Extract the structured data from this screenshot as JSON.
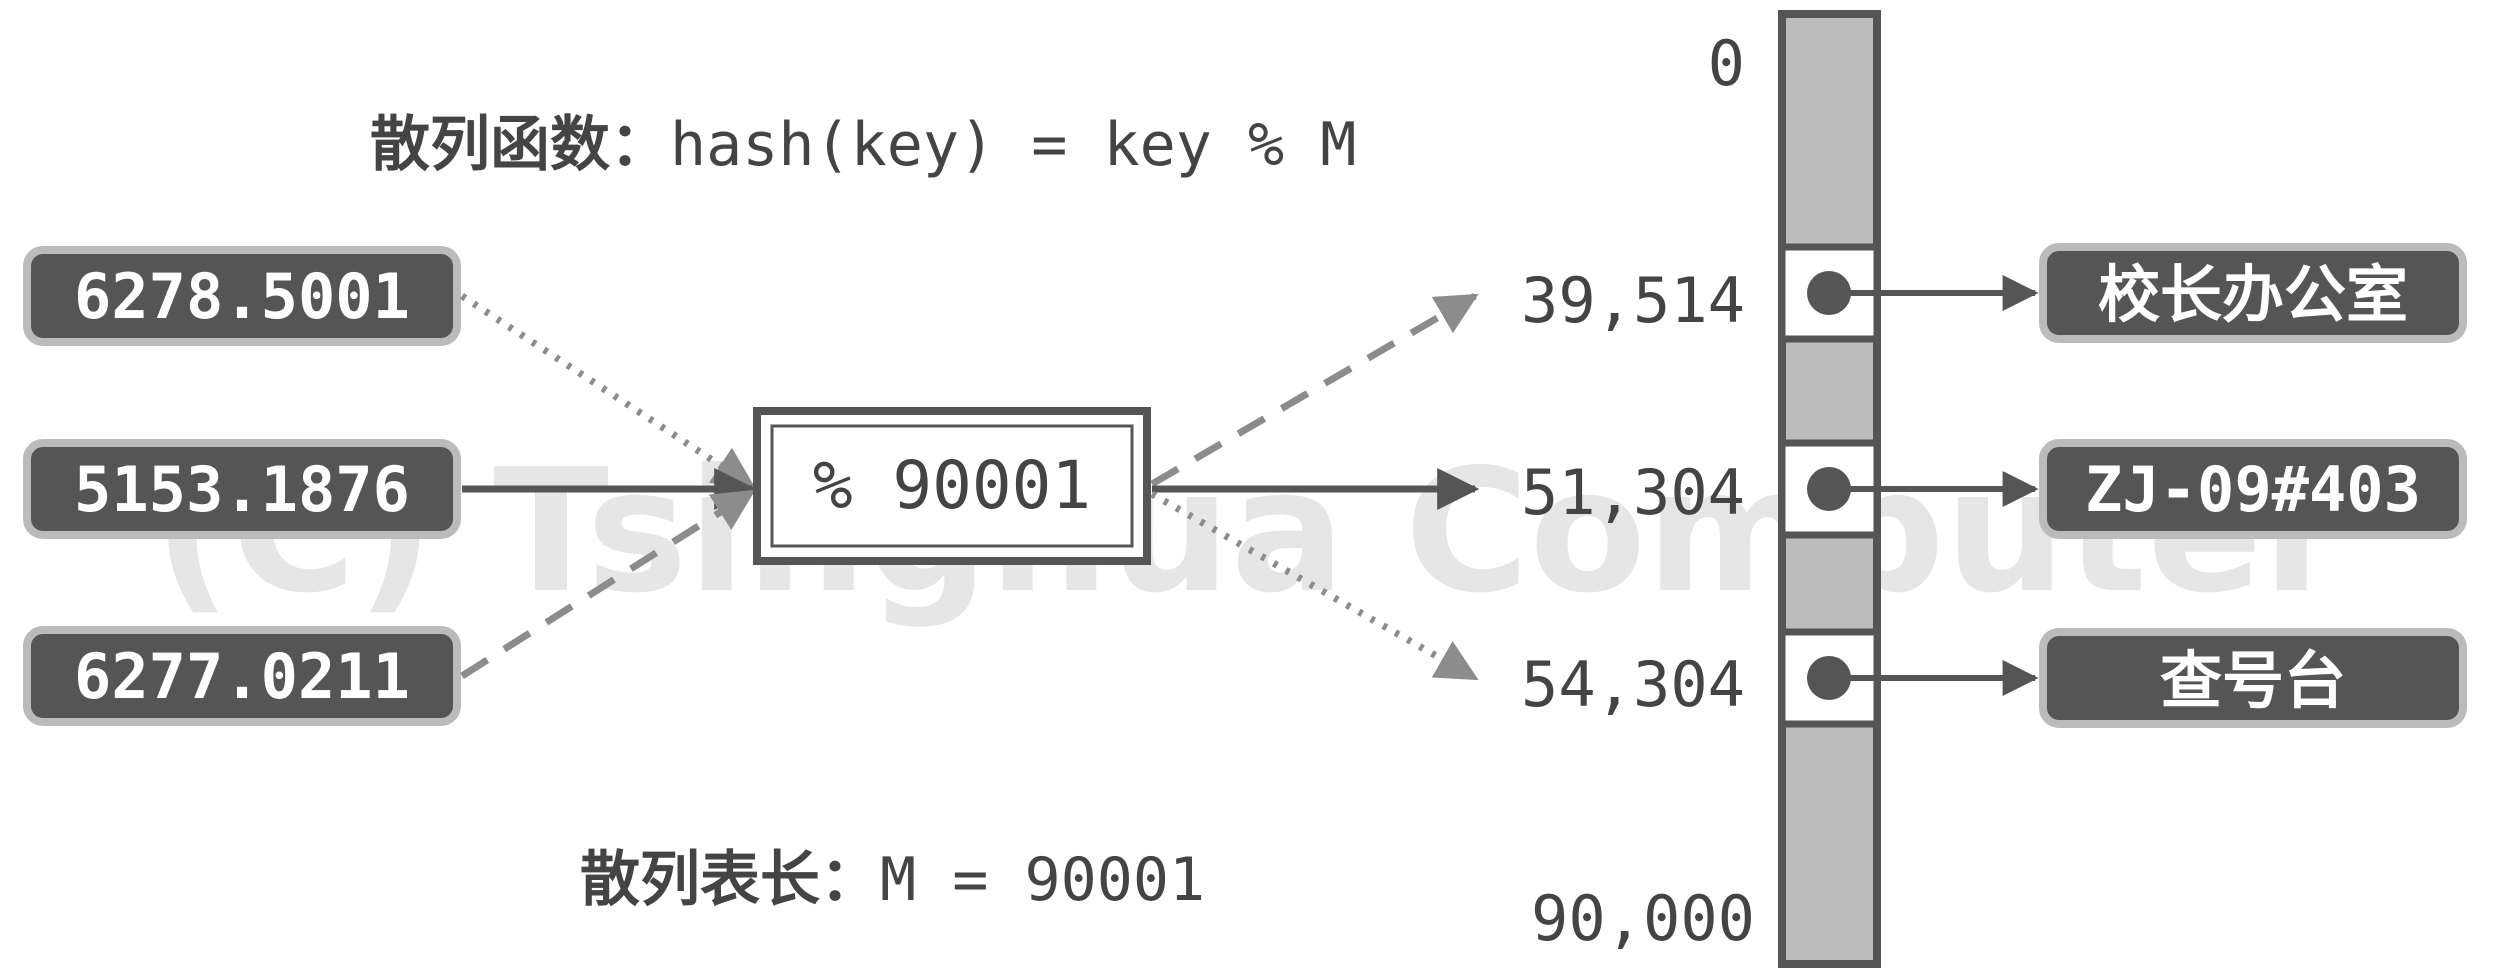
{
  "hash_function": {
    "label": "散列函数：",
    "formula": "hash(key) = key % M"
  },
  "table_length": {
    "label": "散列表长：",
    "formula": "M = 90001"
  },
  "keys": [
    {
      "text": "6278.5001",
      "edge_style": "dotted"
    },
    {
      "text": "5153.1876",
      "edge_style": "solid"
    },
    {
      "text": "6277.0211",
      "edge_style": "dashed"
    }
  ],
  "operator": {
    "text": "% 90001"
  },
  "bucket_indices": {
    "first": "0",
    "last": "90,000",
    "slots": [
      "39,514",
      "51,304",
      "54,304"
    ]
  },
  "values": [
    "校长办公室",
    "ZJ-09#403",
    "查号台"
  ],
  "watermark": "(C) Tsinghua Computer",
  "colors": {
    "pill_fill": "#555555",
    "pill_border": "#bbbbbb",
    "text_dark": "#444444",
    "edge": "#8c8c8c",
    "table_fill": "#bcbcbc",
    "table_border": "#555555"
  }
}
